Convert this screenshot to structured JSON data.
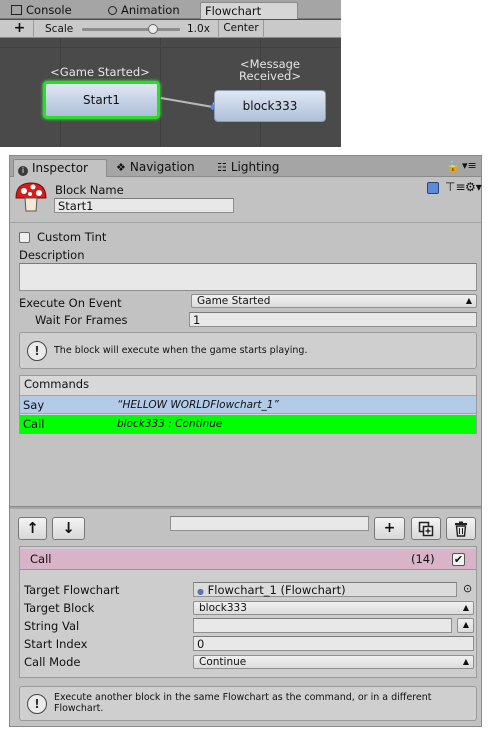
{
  "flowchart_window": {
    "tabs": [
      {
        "label": "Console",
        "icon": "console-icon"
      },
      {
        "label": "Animation",
        "icon": "clock-icon"
      },
      {
        "label": "Flowchart",
        "icon": ""
      }
    ],
    "toolbar": {
      "add_label": "+",
      "scale_label": "Scale",
      "scale_value": "1.0x",
      "scale_fraction": 0.72,
      "center_label": "Center"
    },
    "nodes": [
      {
        "event_label": "<Game Started>",
        "name": "Start1",
        "selected": true
      },
      {
        "event_label_line1": "<Message",
        "event_label_line2": "Received>",
        "name": "block333",
        "selected": false
      }
    ]
  },
  "inspector": {
    "tabs": [
      {
        "label": "Inspector",
        "icon": "info-icon"
      },
      {
        "label": "Navigation",
        "icon": "navigation-icon"
      },
      {
        "label": "Lighting",
        "icon": "lighting-icon"
      }
    ],
    "block_name_label": "Block Name",
    "block_name_value": "Start1",
    "custom_tint_label": "Custom Tint",
    "custom_tint_checked": false,
    "description_label": "Description",
    "description_value": "",
    "execute_on_event_label": "Execute On Event",
    "execute_on_event_value": "Game Started",
    "wait_for_frames_label": "Wait For Frames",
    "wait_for_frames_value": "1",
    "event_help": "The block will execute when the game starts playing.",
    "commands_header": "Commands",
    "commands": [
      {
        "name": "Say",
        "summary": "“HELLOW WORLDFlowchart_1”",
        "row_color": "#b3cbe6"
      },
      {
        "name": "Call",
        "summary": "block333 : Continue",
        "row_color": "#00ff00"
      }
    ],
    "command_toolbar": {
      "up_label": "↑",
      "down_label": "↓",
      "search_value": "",
      "add_label": "+"
    },
    "call_panel": {
      "title": "Call",
      "index": "(14)",
      "enabled": true,
      "header_color": "#d9b3c7",
      "fields": {
        "target_flowchart_label": "Target Flowchart",
        "target_flowchart_value": "Flowchart_1 (Flowchart)",
        "target_block_label": "Target Block",
        "target_block_value": "block333",
        "string_val_label": "String Val",
        "string_val_value": "",
        "start_index_label": "Start Index",
        "start_index_value": "0",
        "call_mode_label": "Call Mode",
        "call_mode_value": "Continue"
      },
      "help_line1": "Execute another block in the same Flowchart as the command, or in a different",
      "help_line2": "Flowchart."
    }
  },
  "colors": {
    "selected_node_border": "#2bdc2b",
    "say_row": "#b3cbe6",
    "call_row": "#00ff00",
    "call_header": "#d9b3c7"
  }
}
